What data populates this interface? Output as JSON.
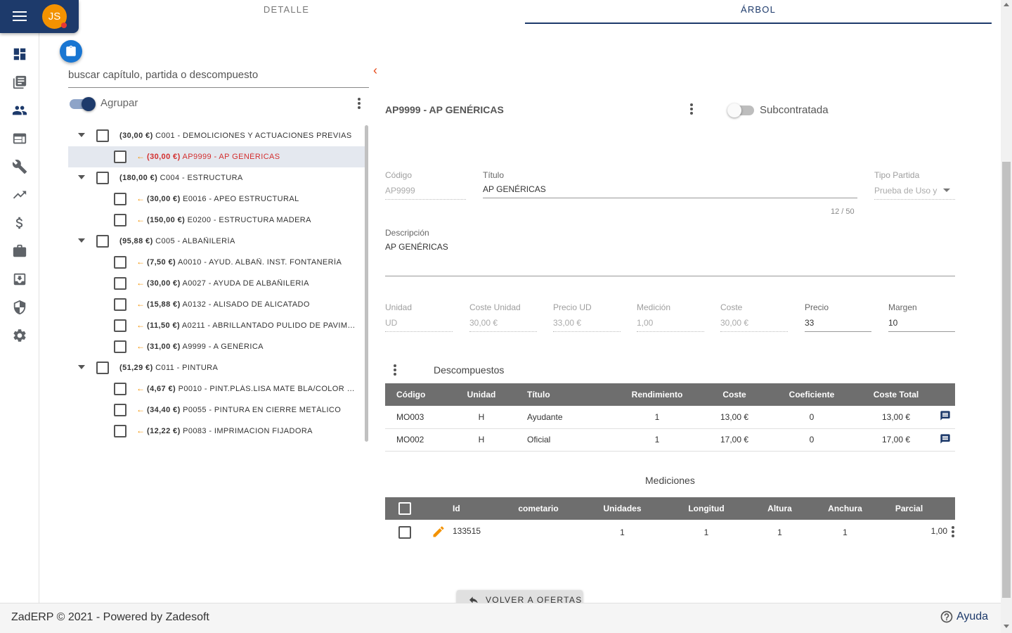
{
  "header": {
    "avatar_initials": "JS"
  },
  "tabs": [
    {
      "label": "DETALLE",
      "active": false
    },
    {
      "label": "ÁRBOL",
      "active": true
    }
  ],
  "nav_icons": [
    "dashboard-icon",
    "library-icon",
    "people-icon",
    "web-icon",
    "wrench-icon",
    "trending-up-icon",
    "dollar-icon",
    "briefcase-icon",
    "archive-icon",
    "shield-icon",
    "gear-icon"
  ],
  "tree_panel": {
    "search_placeholder": "buscar capítulo, partida o descompuesto",
    "agrupar_label": "Agrupar",
    "rows": [
      {
        "amount": "(30,00 €)",
        "name": "C001 - DEMOLICIONES Y ACTUACIONES PREVIAS",
        "level": 0
      },
      {
        "amount": "(30,00 €)",
        "name": "AP9999 - AP GENÉRICAS",
        "level": 1,
        "selected": true
      },
      {
        "amount": "(180,00 €)",
        "name": "C004 - ESTRUCTURA",
        "level": 0
      },
      {
        "amount": "(30,00 €)",
        "name": "E0016 - APEO ESTRUCTURAL",
        "level": 1
      },
      {
        "amount": "(150,00 €)",
        "name": "E0200 - ESTRUCTURA MADERA",
        "level": 1
      },
      {
        "amount": "(95,88 €)",
        "name": "C005 - ALBAÑILERÍA",
        "level": 0
      },
      {
        "amount": "(7,50 €)",
        "name": "A0010 - AYUD. ALBAÑ. INST. FONTANERÍA",
        "level": 1
      },
      {
        "amount": "(30,00 €)",
        "name": "A0027 - AYUDA DE ALBAÑILERIA",
        "level": 1
      },
      {
        "amount": "(15,88 €)",
        "name": "A0132 - ALISADO DE ALICATADO",
        "level": 1
      },
      {
        "amount": "(11,50 €)",
        "name": "A0211 - ABRILLANTADO PULIDO DE PAVIMEN…",
        "level": 1
      },
      {
        "amount": "(31,00 €)",
        "name": "A9999 - A GENÉRICA",
        "level": 1
      },
      {
        "amount": "(51,29 €)",
        "name": "C011 - PINTURA",
        "level": 0
      },
      {
        "amount": "(4,67 €)",
        "name": "P0010 - PINT.PLÁS.LISA MATE BLA/COLOR INT…",
        "level": 1
      },
      {
        "amount": "(34,40 €)",
        "name": "P0055 - PINTURA EN CIERRE METÁLICO",
        "level": 1
      },
      {
        "amount": "(12,22 €)",
        "name": "P0083 - IMPRIMACION FIJADORA",
        "level": 1
      }
    ]
  },
  "detail": {
    "title": "AP9999 - AP GENÉRICAS",
    "subcontratada_label": "Subcontratada",
    "codigo": {
      "label": "Código",
      "value": "AP9999"
    },
    "titulo": {
      "label": "Título",
      "value": "AP GENÉRICAS",
      "counter": "12 / 50"
    },
    "tipo_partida": {
      "label": "Tipo Partida",
      "value": "Prueba de Uso y"
    },
    "descripcion": {
      "label": "Descripción",
      "value": "AP GENÉRICAS"
    },
    "unidad": {
      "label": "Unidad",
      "value": "UD"
    },
    "coste_unidad": {
      "label": "Coste Unidad",
      "value": "30,00 €"
    },
    "precio_ud": {
      "label": "Precio UD",
      "value": "33,00 €"
    },
    "medicion": {
      "label": "Medición",
      "value": "1,00"
    },
    "coste": {
      "label": "Coste",
      "value": "30,00 €"
    },
    "precio": {
      "label": "Precio",
      "value": "33"
    },
    "margen": {
      "label": "Margen",
      "value": "10"
    }
  },
  "descompuestos": {
    "title": "Descompuestos",
    "columns": [
      "Código",
      "Unidad",
      "Título",
      "Rendimiento",
      "Coste",
      "Coeficiente",
      "Coste Total"
    ],
    "rows": [
      [
        "MO003",
        "H",
        "Ayudante",
        "1",
        "13,00 €",
        "0",
        "13,00 €"
      ],
      [
        "MO002",
        "H",
        "Oficial",
        "1",
        "17,00 €",
        "0",
        "17,00 €"
      ]
    ]
  },
  "mediciones": {
    "title": "Mediciones",
    "columns": [
      "Id",
      "cometario",
      "Unidades",
      "Longitud",
      "Altura",
      "Anchura",
      "Parcial"
    ],
    "rows": [
      [
        "133515",
        "",
        "1",
        "1",
        "1",
        "1",
        "1,00"
      ]
    ]
  },
  "volver_label": "VOLVER A OFERTAS",
  "footer": {
    "copyright": "ZadERP © 2021 - Powered by Zadesoft",
    "help": "Ayuda"
  },
  "colors": {
    "primary": "#1d3a6b",
    "accent": "#f39200",
    "danger": "#d32f2f"
  }
}
